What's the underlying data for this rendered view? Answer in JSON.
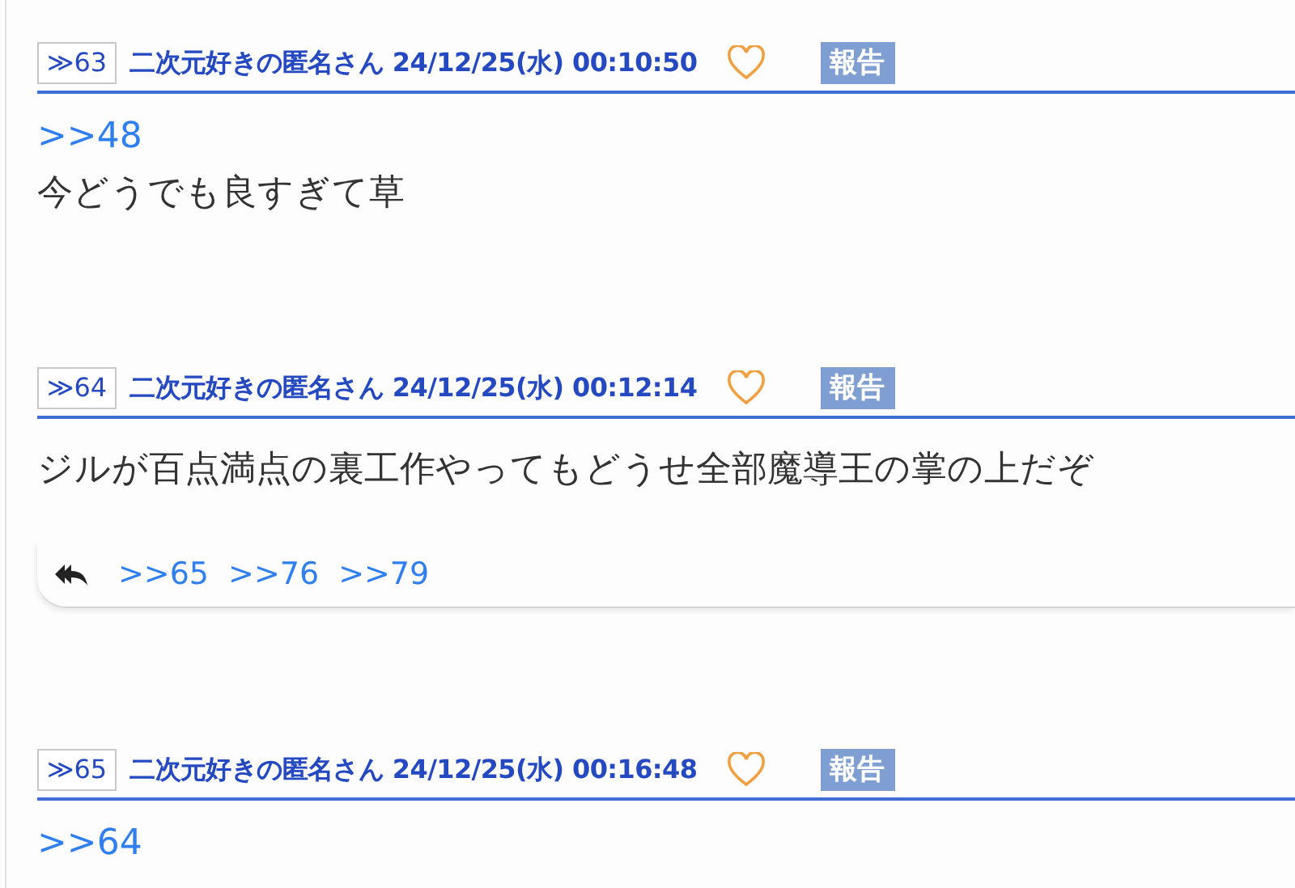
{
  "posts": [
    {
      "number": "≫63",
      "author": "二次元好きの匿名さん",
      "date": "24/12/25(水) 00:10:50",
      "report": "報告",
      "anchors": [
        ">>48"
      ],
      "text": "今どうでも良すぎて草"
    },
    {
      "number": "≫64",
      "author": "二次元好きの匿名さん",
      "date": "24/12/25(水) 00:12:14",
      "report": "報告",
      "text": "ジルが百点満点の裏工作やってもどうせ全部魔導王の掌の上だぞ",
      "replies": [
        ">>65",
        ">>76",
        ">>79"
      ]
    },
    {
      "number": "≫65",
      "author": "二次元好きの匿名さん",
      "date": "24/12/25(水) 00:16:48",
      "report": "報告",
      "anchors": [
        ">>64"
      ]
    }
  ]
}
